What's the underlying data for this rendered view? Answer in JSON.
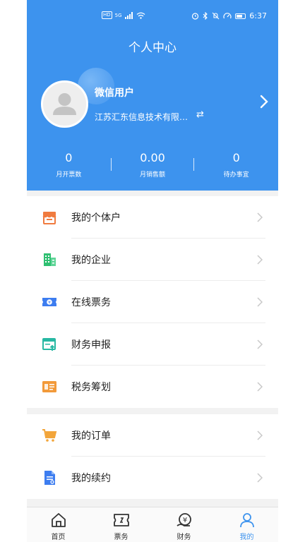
{
  "status_bar": {
    "left_badges": [
      "HD",
      "5G"
    ],
    "time": "6:37"
  },
  "header": {
    "title": "个人中心"
  },
  "profile": {
    "name": "微信用户",
    "company": "江苏汇东信息技术有限…"
  },
  "stats": [
    {
      "value": "0",
      "label": "月开票数"
    },
    {
      "value": "0.00",
      "label": "月销售额"
    },
    {
      "value": "0",
      "label": "待办事宜"
    }
  ],
  "menu": {
    "group1": [
      {
        "label": "我的个体户",
        "icon": "shop-icon",
        "color": "#f07b3f"
      },
      {
        "label": "我的企业",
        "icon": "building-icon",
        "color": "#2fbf71"
      },
      {
        "label": "在线票务",
        "icon": "ticket-icon",
        "color": "#3d7df0"
      },
      {
        "label": "财务申报",
        "icon": "report-icon",
        "color": "#27b8a3"
      },
      {
        "label": "税务筹划",
        "icon": "plan-icon",
        "color": "#f29a3a"
      }
    ],
    "group2": [
      {
        "label": "我的订单",
        "icon": "cart-icon",
        "color": "#f2a53a"
      },
      {
        "label": "我的续约",
        "icon": "document-icon",
        "color": "#3d7df0"
      }
    ]
  },
  "tabbar": [
    {
      "label": "首页",
      "icon": "home-icon"
    },
    {
      "label": "票务",
      "icon": "ticket-tab-icon"
    },
    {
      "label": "财务",
      "icon": "finance-icon"
    },
    {
      "label": "我的",
      "icon": "user-icon",
      "active": true
    }
  ],
  "colors": {
    "primary": "#3d93ee",
    "background": "#f2f2f2"
  }
}
